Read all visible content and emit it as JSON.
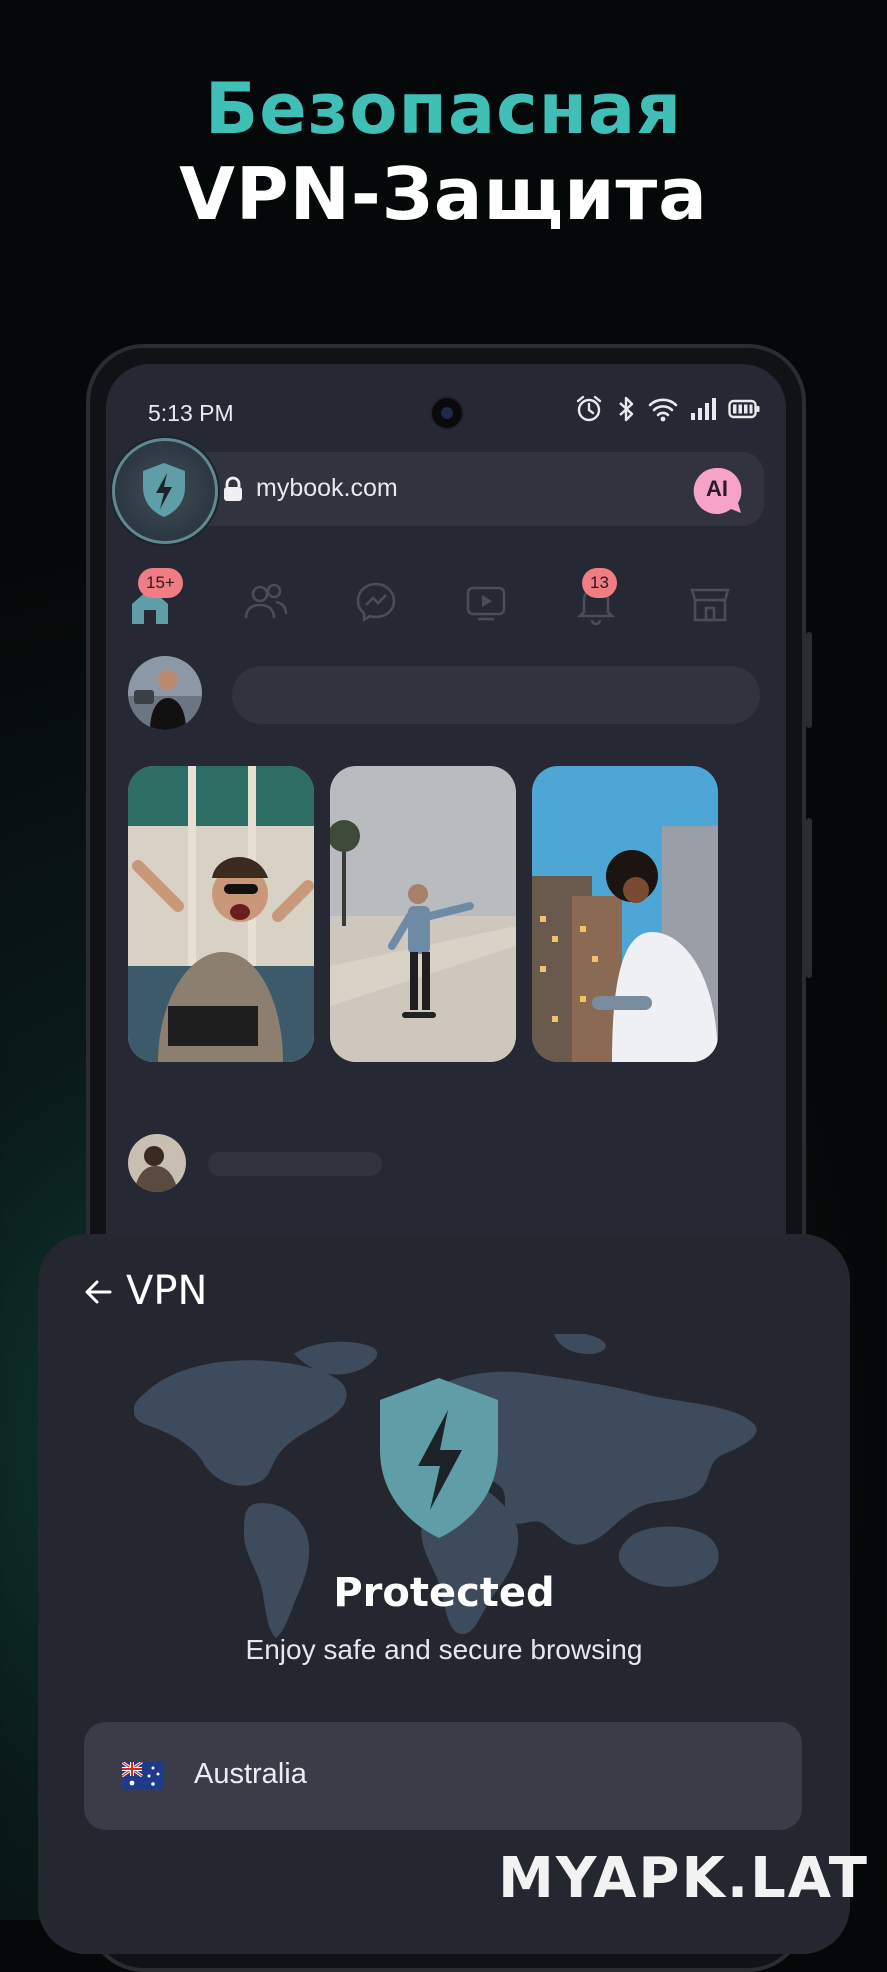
{
  "headline": {
    "line1": "Безопасная",
    "line2": "VPN-Защита"
  },
  "status_bar": {
    "time": "5:13 PM",
    "icons": [
      "alarm-icon",
      "bluetooth-icon",
      "wifi-icon",
      "signal-icon",
      "battery-icon"
    ]
  },
  "browser": {
    "url": "mybook.com",
    "ai_label": "AI"
  },
  "nav": {
    "home_badge": "15+",
    "notifications_badge": "13",
    "icons": [
      "home-icon",
      "friends-icon",
      "messenger-icon",
      "video-icon",
      "bell-icon",
      "marketplace-icon"
    ]
  },
  "vpn": {
    "title": "VPN",
    "status": "Protected",
    "subtitle": "Enjoy safe and secure browsing",
    "server": "Australia",
    "server_flag": "flag-australia-icon"
  },
  "watermark": "MYAPK.LAT",
  "colors": {
    "accent": "#3fbfb6",
    "shield": "#5f9ea6",
    "badge": "#f07c84",
    "ai_bubble": "#f7a3c8",
    "panel": "#252730"
  }
}
